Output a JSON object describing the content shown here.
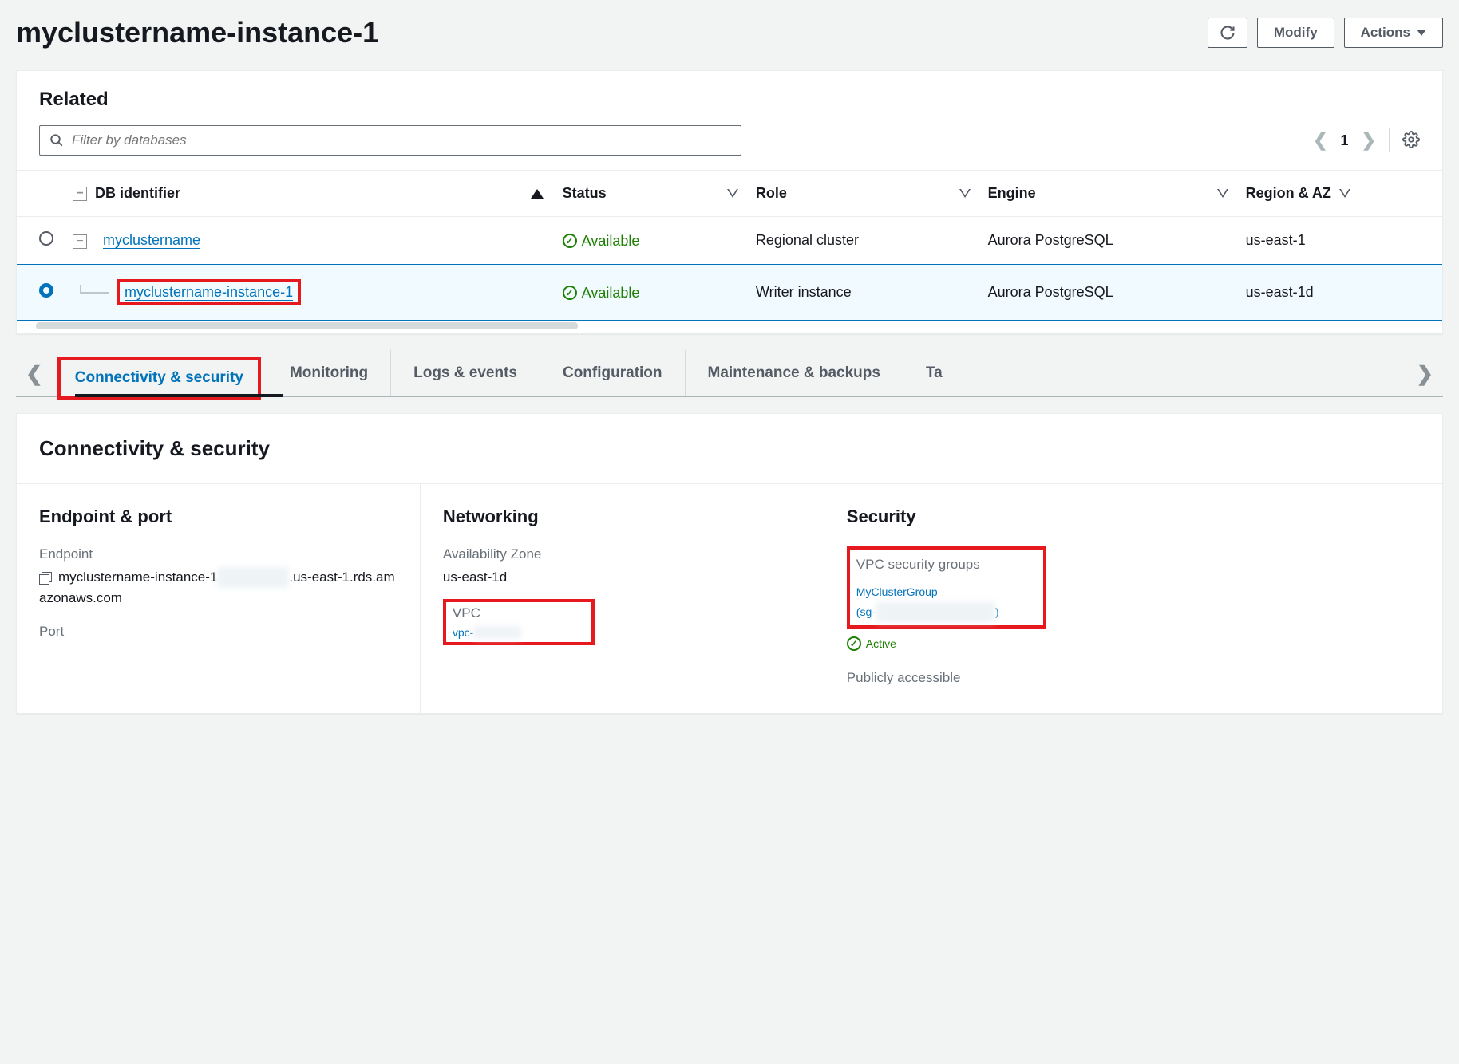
{
  "header": {
    "title": "myclustername-instance-1",
    "modify": "Modify",
    "actions": "Actions"
  },
  "related": {
    "title": "Related",
    "filter_placeholder": "Filter by databases",
    "page": "1",
    "columns": {
      "db_identifier": "DB identifier",
      "status": "Status",
      "role": "Role",
      "engine": "Engine",
      "region_az": "Region & AZ"
    },
    "rows": [
      {
        "selected": false,
        "id": "myclustername",
        "status": "Available",
        "role": "Regional cluster",
        "engine": "Aurora PostgreSQL",
        "region_az": "us-east-1"
      },
      {
        "selected": true,
        "id": "myclustername-instance-1",
        "status": "Available",
        "role": "Writer instance",
        "engine": "Aurora PostgreSQL",
        "region_az": "us-east-1d"
      }
    ]
  },
  "tabs": {
    "connectivity": "Connectivity & security",
    "monitoring": "Monitoring",
    "logs": "Logs & events",
    "configuration": "Configuration",
    "maintenance": "Maintenance & backups",
    "tags_partial": "Ta"
  },
  "detail": {
    "title": "Connectivity & security",
    "endpoint_port": {
      "heading": "Endpoint & port",
      "endpoint_label": "Endpoint",
      "endpoint_prefix": "myclustername-instance-1",
      "endpoint_suffix": ".us-east-1.rds.amazonaws.com",
      "port_label": "Port"
    },
    "networking": {
      "heading": "Networking",
      "az_label": "Availability Zone",
      "az_value": "us-east-1d",
      "vpc_label": "VPC",
      "vpc_value": "vpc-"
    },
    "security": {
      "heading": "Security",
      "sg_label": "VPC security groups",
      "sg_name": "MyClusterGroup",
      "sg_prefix": "(sg-",
      "sg_suffix": ")",
      "active": "Active",
      "public_label": "Publicly accessible"
    }
  }
}
